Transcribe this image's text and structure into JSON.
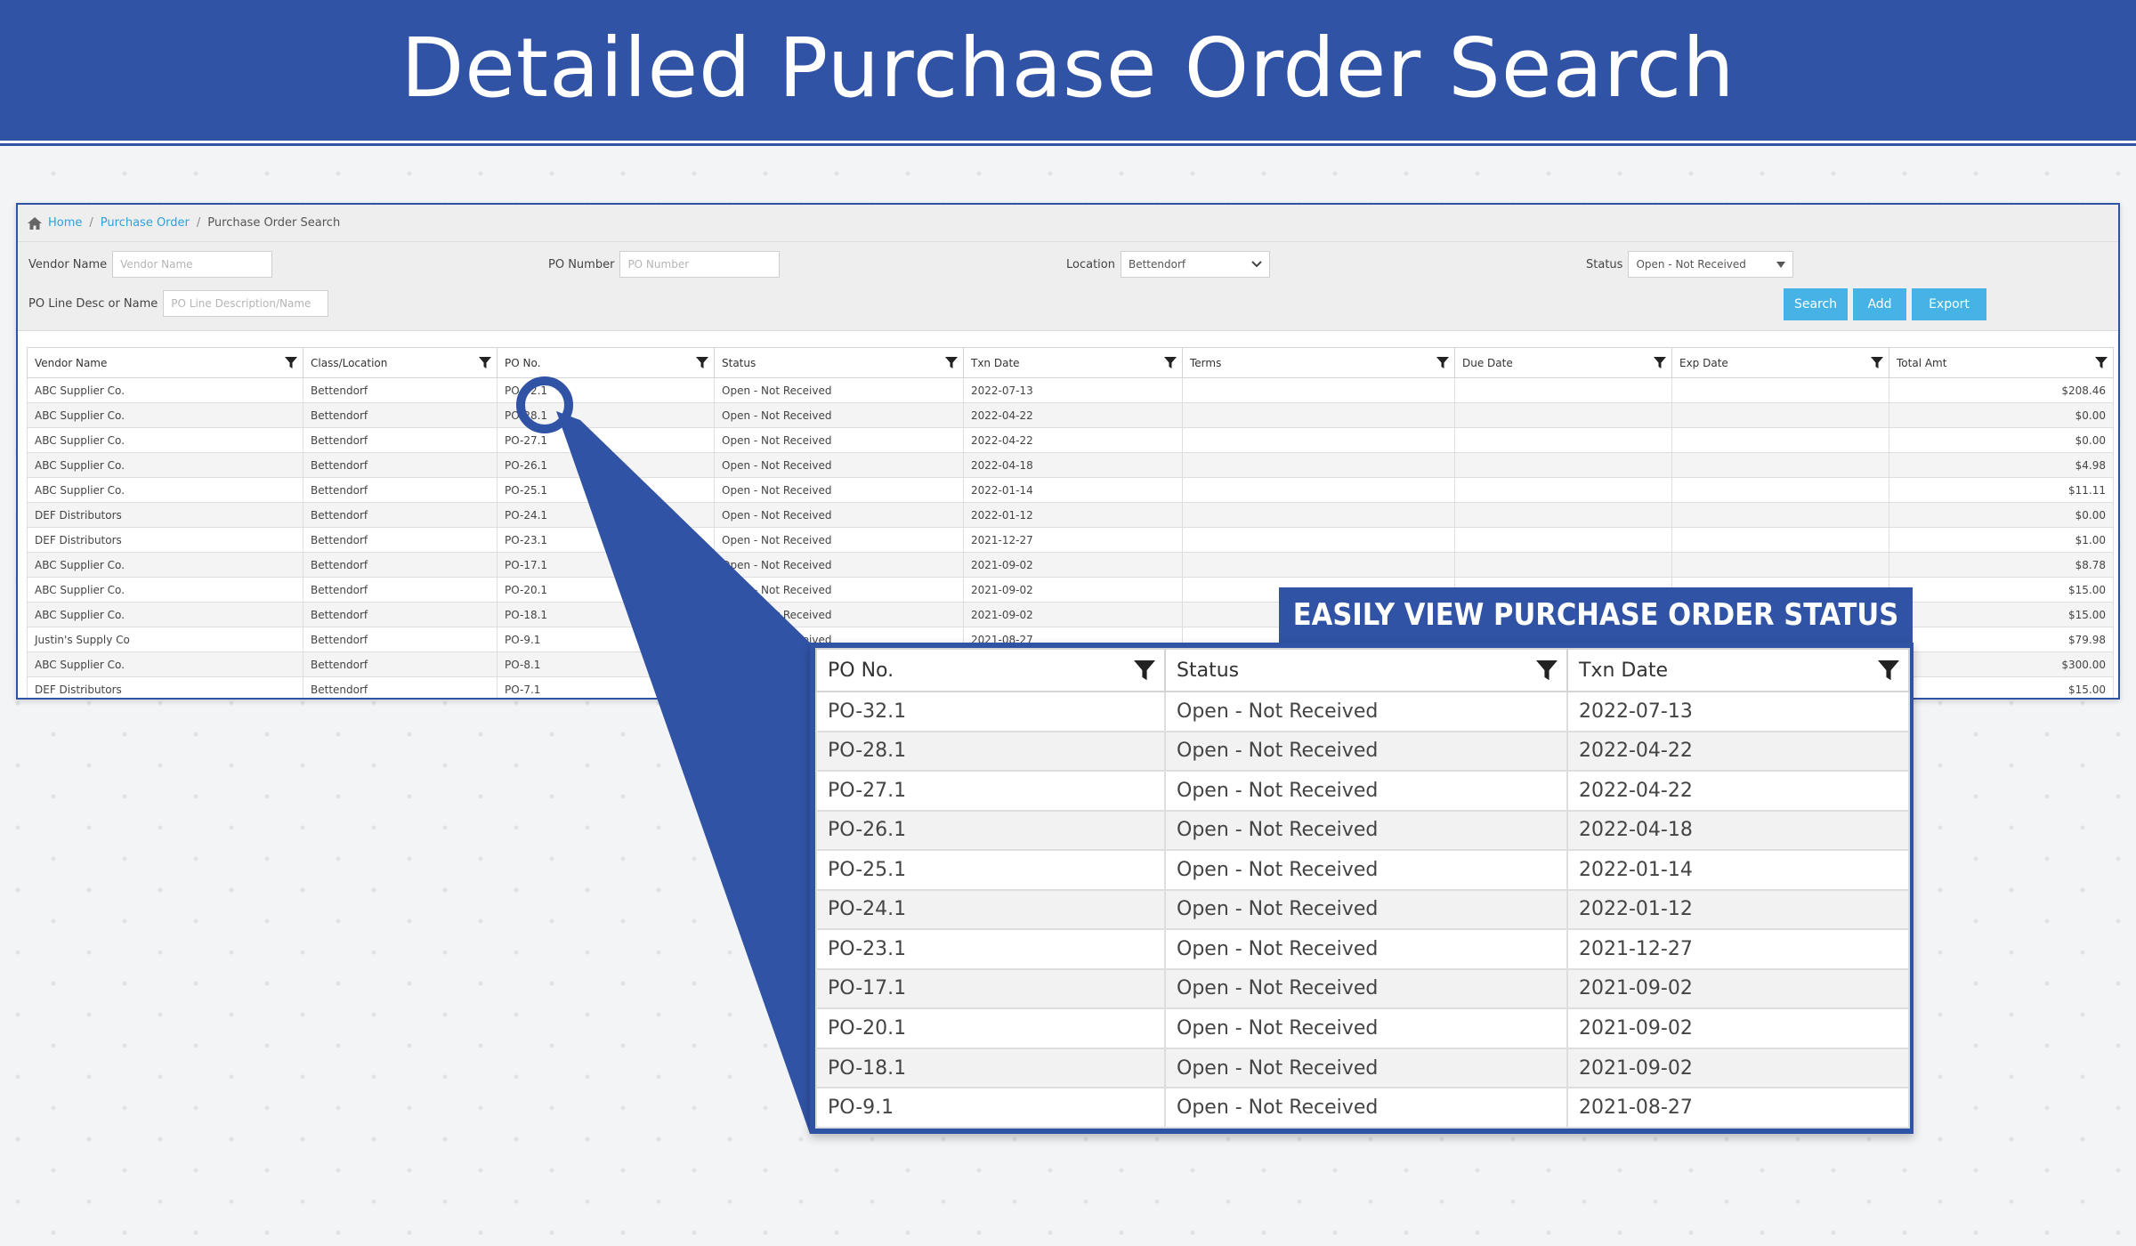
{
  "banner": {
    "title": "Detailed Purchase Order Search"
  },
  "breadcrumb": {
    "home": "Home",
    "section": "Purchase Order",
    "current": "Purchase Order Search",
    "sep": "/"
  },
  "filters": {
    "vendor_label": "Vendor Name",
    "vendor_placeholder": "Vendor Name",
    "po_label": "PO Number",
    "po_placeholder": "PO Number",
    "location_label": "Location",
    "location_value": "Bettendorf",
    "status_label": "Status",
    "status_value": "Open - Not Received",
    "line_label": "PO Line Desc or Name",
    "line_placeholder": "PO Line Description/Name"
  },
  "buttons": {
    "search": "Search",
    "add": "Add",
    "export": "Export"
  },
  "table": {
    "headers": [
      "Vendor Name",
      "Class/Location",
      "PO No.",
      "Status",
      "Txn Date",
      "Terms",
      "Due Date",
      "Exp Date",
      "Total Amt"
    ],
    "rows": [
      [
        "ABC Supplier Co.",
        "Bettendorf",
        "PO-32.1",
        "Open - Not Received",
        "2022-07-13",
        "",
        "",
        "",
        "$208.46"
      ],
      [
        "ABC Supplier Co.",
        "Bettendorf",
        "PO-28.1",
        "Open - Not Received",
        "2022-04-22",
        "",
        "",
        "",
        "$0.00"
      ],
      [
        "ABC Supplier Co.",
        "Bettendorf",
        "PO-27.1",
        "Open - Not Received",
        "2022-04-22",
        "",
        "",
        "",
        "$0.00"
      ],
      [
        "ABC Supplier Co.",
        "Bettendorf",
        "PO-26.1",
        "Open - Not Received",
        "2022-04-18",
        "",
        "",
        "",
        "$4.98"
      ],
      [
        "ABC Supplier Co.",
        "Bettendorf",
        "PO-25.1",
        "Open - Not Received",
        "2022-01-14",
        "",
        "",
        "",
        "$11.11"
      ],
      [
        "DEF Distributors",
        "Bettendorf",
        "PO-24.1",
        "Open - Not Received",
        "2022-01-12",
        "",
        "",
        "",
        "$0.00"
      ],
      [
        "DEF Distributors",
        "Bettendorf",
        "PO-23.1",
        "Open - Not Received",
        "2021-12-27",
        "",
        "",
        "",
        "$1.00"
      ],
      [
        "ABC Supplier Co.",
        "Bettendorf",
        "PO-17.1",
        "Open - Not Received",
        "2021-09-02",
        "",
        "",
        "",
        "$8.78"
      ],
      [
        "ABC Supplier Co.",
        "Bettendorf",
        "PO-20.1",
        "Open - Not Received",
        "2021-09-02",
        "",
        "",
        "",
        "$15.00"
      ],
      [
        "ABC Supplier Co.",
        "Bettendorf",
        "PO-18.1",
        "Open - Not Received",
        "2021-09-02",
        "",
        "",
        "",
        "$15.00"
      ],
      [
        "Justin's Supply Co",
        "Bettendorf",
        "PO-9.1",
        "Open - Not Received",
        "2021-08-27",
        "",
        "",
        "",
        "$79.98"
      ],
      [
        "ABC Supplier Co.",
        "Bettendorf",
        "PO-8.1",
        "Open - Not Received",
        "",
        "",
        "",
        "",
        "$300.00"
      ],
      [
        "DEF Distributors",
        "Bettendorf",
        "PO-7.1",
        "Open - Not Received",
        "",
        "",
        "",
        "",
        "$15.00"
      ]
    ]
  },
  "callout": {
    "label": "EASILY VIEW PURCHASE ORDER STATUS",
    "headers": [
      "PO No.",
      "Status",
      "Txn Date"
    ],
    "rows": [
      [
        "PO-32.1",
        "Open - Not Received",
        "2022-07-13"
      ],
      [
        "PO-28.1",
        "Open - Not Received",
        "2022-04-22"
      ],
      [
        "PO-27.1",
        "Open - Not Received",
        "2022-04-22"
      ],
      [
        "PO-26.1",
        "Open - Not Received",
        "2022-04-18"
      ],
      [
        "PO-25.1",
        "Open - Not Received",
        "2022-01-14"
      ],
      [
        "PO-24.1",
        "Open - Not Received",
        "2022-01-12"
      ],
      [
        "PO-23.1",
        "Open - Not Received",
        "2021-12-27"
      ],
      [
        "PO-17.1",
        "Open - Not Received",
        "2021-09-02"
      ],
      [
        "PO-20.1",
        "Open - Not Received",
        "2021-09-02"
      ],
      [
        "PO-18.1",
        "Open - Not Received",
        "2021-09-02"
      ],
      [
        "PO-9.1",
        "Open - Not Received",
        "2021-08-27"
      ]
    ]
  },
  "colors": {
    "brand": "#3153a5",
    "button": "#45b3e5",
    "link": "#2ba3d6"
  },
  "icons": {
    "home": "home-icon",
    "filter": "filter-icon",
    "dropdown": "chevron-down-icon"
  }
}
